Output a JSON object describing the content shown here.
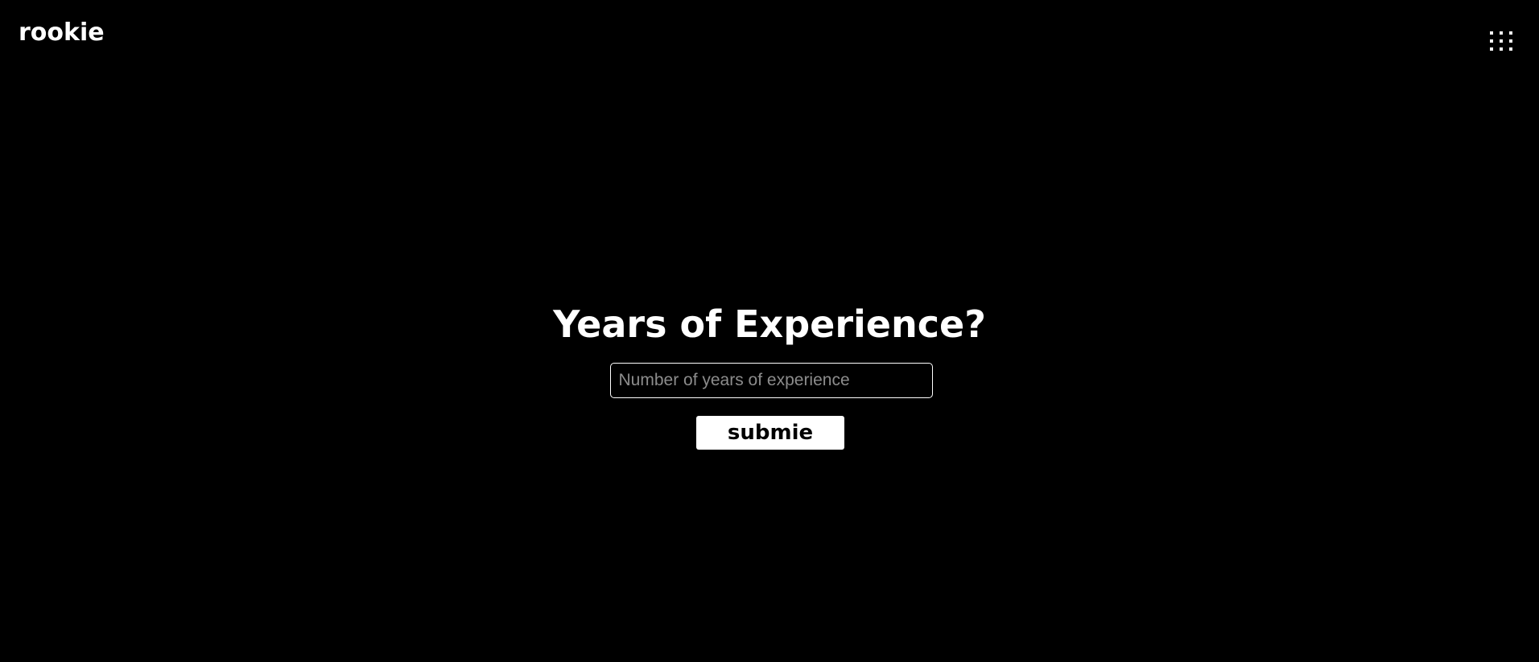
{
  "header": {
    "brand": "rookie",
    "menu_icon": "grid-menu-icon"
  },
  "main": {
    "title": "Years of Experience?",
    "experience_input": {
      "value": "",
      "placeholder": "Number of years of experience"
    },
    "submit_label": "submie"
  },
  "colors": {
    "background": "#000000",
    "foreground": "#ffffff",
    "placeholder": "#8c8c8c"
  }
}
